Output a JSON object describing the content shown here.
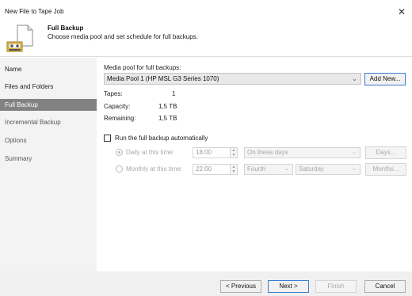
{
  "window": {
    "title": "New File to Tape Job",
    "close_glyph": "✕"
  },
  "header": {
    "title": "Full Backup",
    "subtitle": "Choose media pool and set schedule for full backups.",
    "icon": "tape-backup-icon"
  },
  "sidebar": {
    "items": [
      {
        "label": "Name",
        "active": false
      },
      {
        "label": "Files and Folders",
        "active": false
      },
      {
        "label": "Full Backup",
        "active": true
      },
      {
        "label": "Incremental Backup",
        "active": false
      },
      {
        "label": "Options",
        "active": false
      },
      {
        "label": "Summary",
        "active": false
      }
    ]
  },
  "main": {
    "media_pool_label": "Media pool for full backups:",
    "media_pool_value": "Media Pool 1 (HP MSL G3 Series 1070)",
    "add_new_label": "Add New...",
    "stats": [
      {
        "label": "Tapes:",
        "value": "1"
      },
      {
        "label": "Capacity:",
        "value": "1,5 TB"
      },
      {
        "label": "Remaining:",
        "value": "1,5 TB"
      }
    ],
    "run_auto_label": "Run the full backup automatically",
    "run_auto_checked": false,
    "daily": {
      "label": "Daily at this time:",
      "time": "18:00",
      "days_option": "On these days",
      "button": "Days..."
    },
    "monthly": {
      "label": "Monthly at this time:",
      "time": "22:00",
      "week_option": "Fourth",
      "day_option": "Saturday",
      "button": "Months..."
    }
  },
  "footer": {
    "previous": "< Previous",
    "next": "Next >",
    "finish": "Finish",
    "cancel": "Cancel"
  },
  "colors": {
    "sidebar_bg": "#f3f3f3",
    "active_item_bg": "#828282",
    "footer_bg": "#f0f0f0",
    "primary_border": "#3c7bd0"
  }
}
